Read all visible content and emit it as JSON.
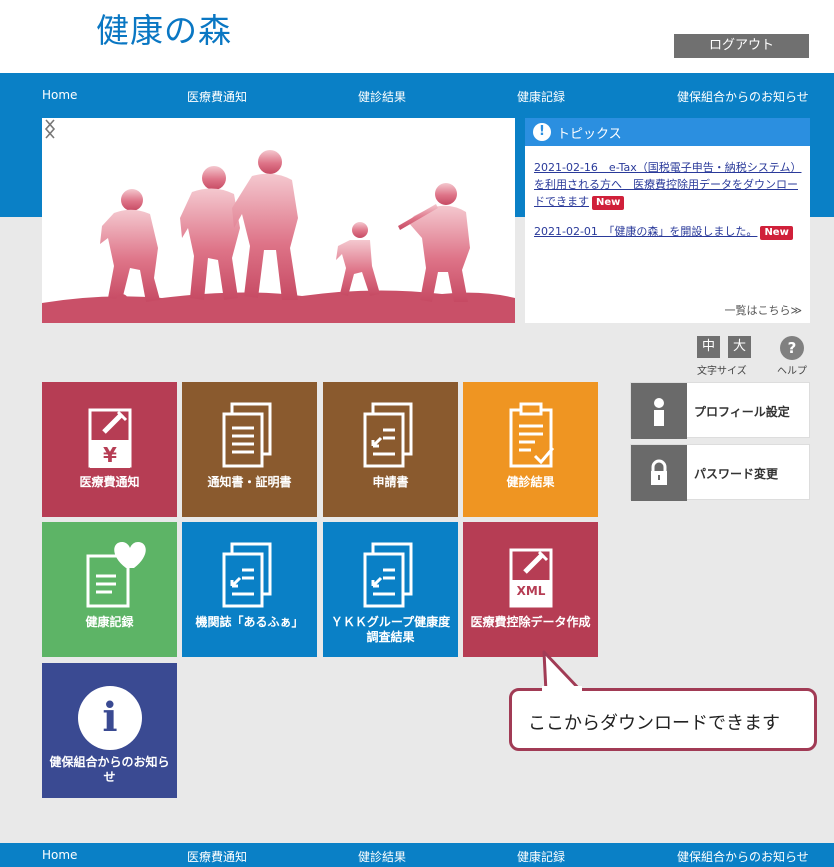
{
  "header": {
    "logo": "健康の森",
    "logout": "ログアウト"
  },
  "nav": {
    "items": [
      "Home",
      "医療費通知",
      "健診結果",
      "健康記録",
      "健保組合からのお知らせ"
    ]
  },
  "topics": {
    "title": "トピックス",
    "items": [
      {
        "text": "2021-02-16　e-Tax（国税電子申告・納税システム）を利用される方へ　医療費控除用データをダウンロードできます",
        "badge": "New"
      },
      {
        "text": "2021-02-01　「健康の森」を開設しました。",
        "badge": "New"
      }
    ],
    "more": "一覧はこちら≫"
  },
  "font_size": {
    "medium": "中",
    "large": "大",
    "label": "文字サイズ"
  },
  "help": {
    "icon": "?",
    "label": "ヘルプ"
  },
  "tiles": [
    {
      "label": "医療費通知",
      "color": "#b63d54",
      "icon": "yen-syringe-icon"
    },
    {
      "label": "通知書・証明書",
      "color": "#8a5a2e",
      "icon": "documents-icon"
    },
    {
      "label": "申請書",
      "color": "#8a5a2e",
      "icon": "application-icon"
    },
    {
      "label": "健診結果",
      "color": "#ef9522",
      "icon": "checklist-icon"
    },
    {
      "label": "健康記録",
      "color": "#5db466",
      "icon": "heart-note-icon"
    },
    {
      "label": "機関誌「あるふぁ」",
      "color": "#0a80c6",
      "icon": "magazine-icon"
    },
    {
      "label": "ＹＫＫグループ健康度調査結果",
      "color": "#0a80c6",
      "icon": "survey-icon"
    },
    {
      "label": "医療費控除データ作成",
      "color": "#b63d54",
      "icon": "xml-icon",
      "xml": "XML"
    },
    {
      "label": "健保組合からのお知らせ",
      "color": "#3a4a92",
      "icon": "info-icon",
      "info": "i"
    }
  ],
  "side": {
    "profile": "プロフィール設定",
    "password": "パスワード変更"
  },
  "callout": "ここからダウンロードできます"
}
